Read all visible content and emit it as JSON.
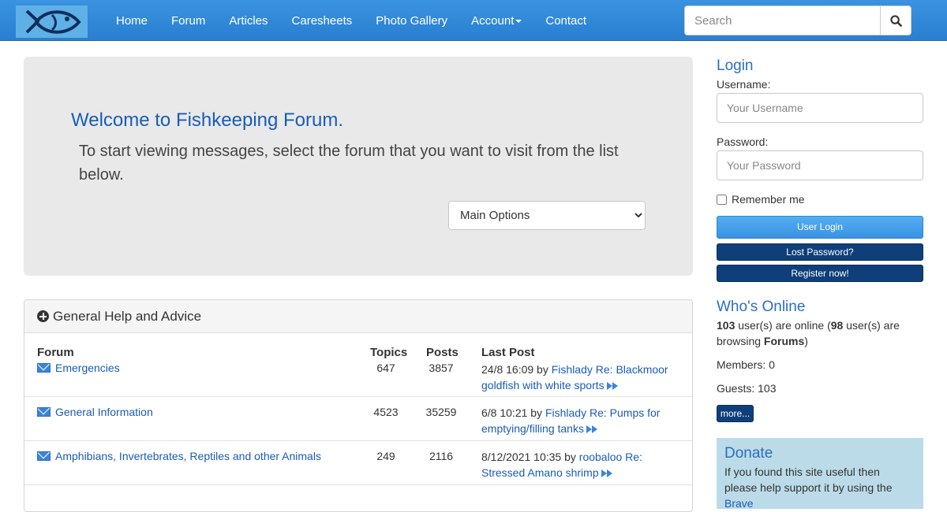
{
  "nav": {
    "links": [
      "Home",
      "Forum",
      "Articles",
      "Caresheets",
      "Photo Gallery",
      "Account",
      "Contact"
    ],
    "search_placeholder": "Search"
  },
  "jumbo": {
    "title": "Welcome to Fishkeeping Forum.",
    "intro": "To start viewing messages, select the forum that you want to visit from the list below.",
    "select_value": "Main Options"
  },
  "panel": {
    "heading": "General Help and Advice",
    "headers": {
      "forum": "Forum",
      "topics": "Topics",
      "posts": "Posts",
      "last": "Last Post"
    },
    "rows": [
      {
        "name": "Emergencies",
        "topics": "647",
        "posts": "3857",
        "last_date": "24/8 16:09 by",
        "last_user": "Fishlady",
        "last_topic": "Re: Blackmoor goldfish with white sports"
      },
      {
        "name": "General Information",
        "topics": "4523",
        "posts": "35259",
        "last_date": "6/8 10:21 by",
        "last_user": "Fishlady",
        "last_topic": "Re: Pumps for emptying/filling tanks"
      },
      {
        "name": "Amphibians, Invertebrates, Reptiles and other Animals",
        "topics": "249",
        "posts": "2116",
        "last_date": "8/12/2021 10:35 by",
        "last_user": "roobaloo",
        "last_topic": "Re: Stressed Amano shrimp"
      }
    ]
  },
  "login": {
    "title": "Login",
    "username_label": "Username:",
    "username_placeholder": "Your Username",
    "password_label": "Password:",
    "password_placeholder": "Your Password",
    "remember": "Remember me",
    "login_btn": "User Login",
    "lost_btn": "Lost Password?",
    "register_btn": "Register now!"
  },
  "online": {
    "title": "Who's Online",
    "users": "103",
    "text1": " user(s) are online (",
    "browsing": "98",
    "text2": " user(s) are browsing ",
    "section": "Forums",
    "text3": ")",
    "members": "Members: 0",
    "guests": "Guests: 103",
    "more_btn": "more..."
  },
  "donate": {
    "title": "Donate",
    "text": "If you found this site useful then please help support it by using the ",
    "link": "Brave"
  },
  "colors": {
    "nav": "#3a93e0",
    "link": "#1a5cb5",
    "dark_btn": "#0f3f7a",
    "donate_bg": "#bcdbe8"
  }
}
